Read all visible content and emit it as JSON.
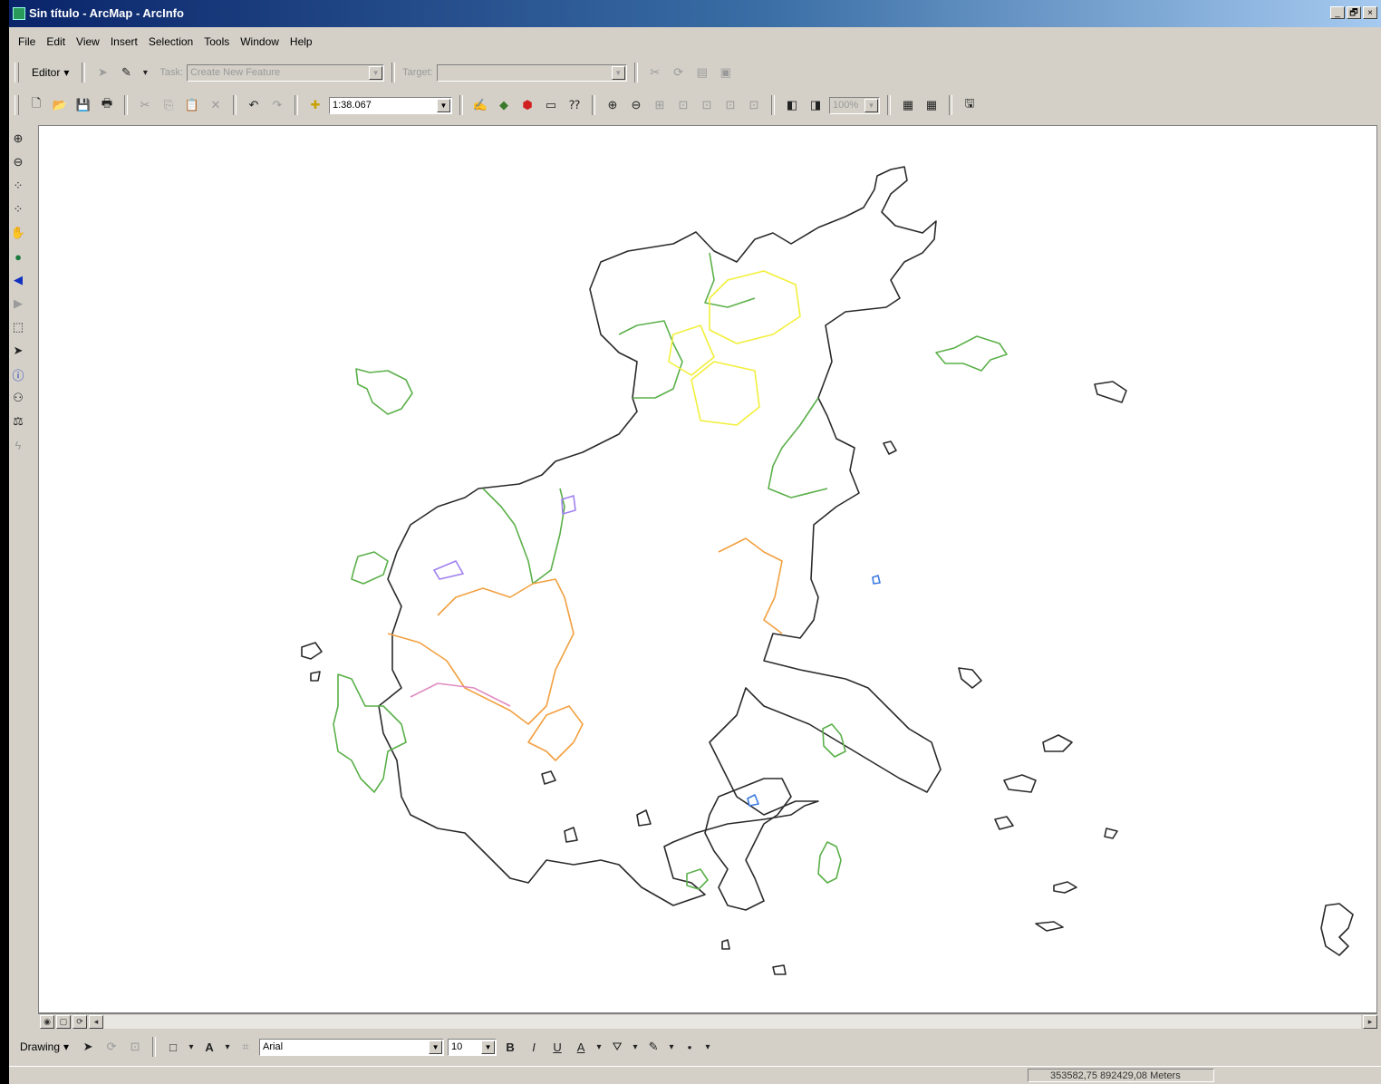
{
  "window": {
    "title": "Sin título - ArcMap - ArcInfo",
    "controls": [
      "_",
      "🗗",
      "×"
    ]
  },
  "menu": [
    "File",
    "Edit",
    "View",
    "Insert",
    "Selection",
    "Tools",
    "Window",
    "Help"
  ],
  "editor": {
    "label": "Editor",
    "task_label": "Task:",
    "task_value": "Create New Feature",
    "target_label": "Target:",
    "target_value": ""
  },
  "standard": {
    "scale": "1:38.067",
    "zoom_percent": "100%"
  },
  "drawing": {
    "label": "Drawing",
    "font": "Arial",
    "size": "10",
    "bold": "B",
    "italic": "I",
    "underline": "U",
    "text_tool": "A"
  },
  "status": {
    "coordinates": "353582,75  892429,08 Meters"
  },
  "map": {
    "colors": {
      "coast": "#2a2a2a",
      "green": "#5bb04a",
      "yellow": "#f2ef3a",
      "orange": "#f2a040",
      "pink": "#e08ac0",
      "blue": "#3a7ae0",
      "purple": "#a080f0"
    }
  }
}
